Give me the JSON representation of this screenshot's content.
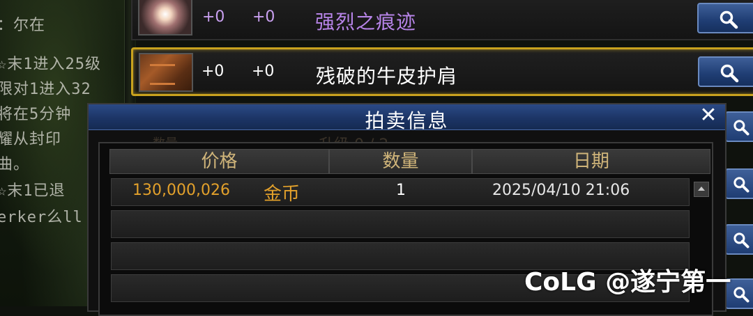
{
  "chat": {
    "lines": [
      "：尔在",
      "☆末1进入25级",
      "限对1进入32",
      "将在5分钟",
      "耀从封印",
      "曲。",
      "☆末1已退",
      "erker么ll"
    ]
  },
  "items": [
    {
      "enh1": "+0",
      "enh2": "+0",
      "name": "强烈之痕迹",
      "icon": "burst-icon"
    },
    {
      "enh1": "+0",
      "enh2": "+0",
      "name": "残破的牛皮护肩",
      "icon": "pauldron-icon"
    }
  ],
  "dialog": {
    "title": "拍卖信息",
    "close": "✕",
    "ghost_level": "升级 0 / 2",
    "ghost_label": "数量",
    "columns": [
      "价格",
      "数量",
      "日期"
    ],
    "rows": [
      {
        "price": "130,000,026",
        "currency": "金币",
        "qty": "1",
        "date": "2025/04/10  21:06"
      }
    ]
  },
  "watermark": {
    "logo": "CoLG",
    "handle": "@遂宁第一"
  },
  "colors": {
    "selected_border": "#c9a21e",
    "price_text": "#e3a12b",
    "rare_item": "#b784e8",
    "header_bar": "#1c3566"
  }
}
